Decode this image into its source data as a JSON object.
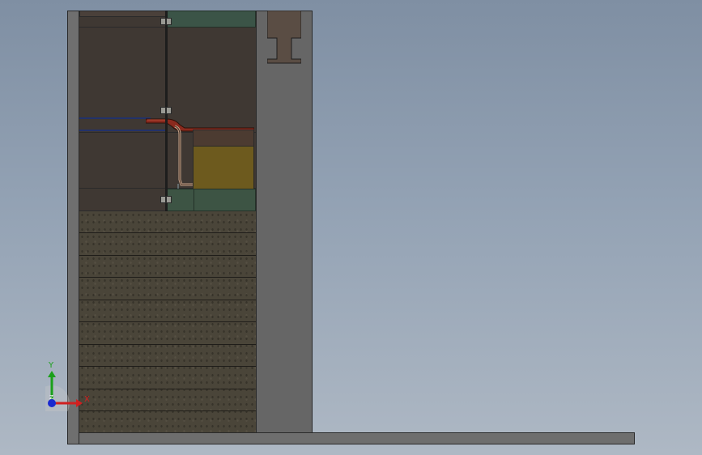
{
  "scene": {
    "description_labels": {
      "axis_x": "X",
      "axis_y": "Y",
      "axis_z": "Z"
    },
    "colors": {
      "background_top": "#7f8fa3",
      "background_bottom": "#aeb8c4",
      "wall": "#6f6f6f",
      "chamber": "#3f3833",
      "green_part": "#3b5447",
      "yellow_part": "#6d5a1e",
      "red_pipe": "#8a2a1e",
      "wire": "#23326a",
      "aggregate": "#4a4539",
      "axis_x": "#d02020",
      "axis_y": "#1aa01a",
      "axis_z": "#1a2ad0"
    },
    "lower_layers_count": 10,
    "icons": [
      "coordinate-triad-icon",
      "i-beam-icon",
      "clamp-icon"
    ]
  }
}
